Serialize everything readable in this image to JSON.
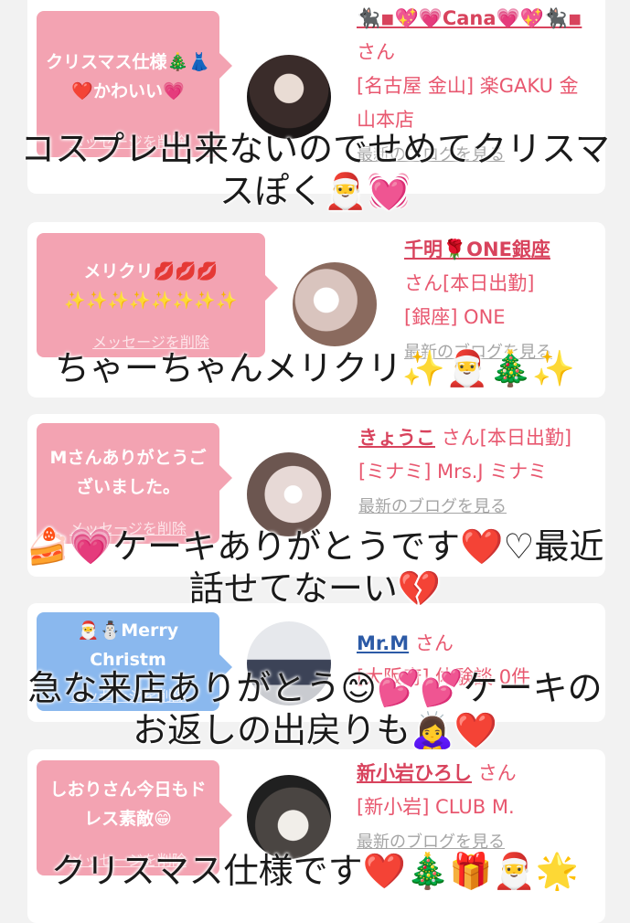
{
  "cards": [
    {
      "bubble_text": "クリスマス仕様🎄👗❤️かわいい💗",
      "delete_label": "メッセージを削除",
      "name": "🐈‍⬛◾💖💗Cana💗💖🐈‍⬛◾",
      "san": "さん",
      "shop": "[名古屋 金山] 楽GAKU 金山本店",
      "blog_link": "最新のブログを見る"
    },
    {
      "bubble_text": "メリクリ💋💋💋✨✨✨✨✨✨✨✨",
      "delete_label": "メッセージを削除",
      "name": "千明🌹ONE銀座",
      "san": "さん[本日出勤]",
      "shop": "[銀座] ONE",
      "blog_link": "最新のブログを見る"
    },
    {
      "bubble_text": "Mさんありがとうございました。",
      "delete_label": "メッセージを削除",
      "name": "きょうこ",
      "san": "さん[本日出勤]",
      "shop": "[ミナミ] Mrs.J ミナミ",
      "blog_link": "最新のブログを見る"
    },
    {
      "bubble_text": "🎅⛄Merry Christm",
      "delete_label": "メッセージを削除",
      "name": "Mr.M",
      "san": "さん",
      "shop": "[大阪府] 体験談 0件",
      "blog_link": ""
    },
    {
      "bubble_text": "しおりさん今日もドレス素敵😁",
      "delete_label": "メッセージを削除",
      "name": "新小岩ひろし",
      "san": "さん",
      "shop": "[新小岩] CLUB M.",
      "blog_link": "最新のブログを見る"
    }
  ],
  "captions": [
    "コスプレ出来ないのでせめてクリスマスぽく🎅💓",
    "ちゃーちゃんメリクリ✨🎅🎄✨",
    "🍰💗ケーキありがとうです❤️♡最近話せてなーい💔",
    "急な来店ありがとう😊💕💕ケーキのお返しの出戻りも🙇‍♀️❤️",
    "クリスマス仕様です❤️🎄🎁🎅🌟"
  ],
  "colors": {
    "bubble_pink": "#f3a3b2",
    "bubble_blue": "#8ab8ee",
    "name_pink": "#d8435d",
    "name_blue": "#2c5aa6",
    "link_gray": "#a5a5a5"
  }
}
